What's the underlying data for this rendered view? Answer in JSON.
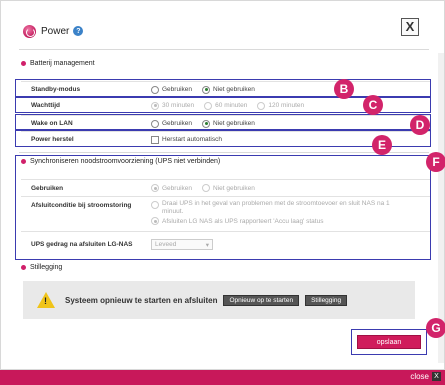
{
  "header": {
    "title": "Power",
    "help_icon": "?",
    "close_icon": "X"
  },
  "battery": {
    "section_title": "Batterij management",
    "standby": {
      "label": "Standby-modus",
      "options": [
        "Gebruiken",
        "Niet gebruiken"
      ],
      "selected": "Niet gebruiken"
    },
    "wait_time": {
      "label": "Wachttijd",
      "options": [
        "30 minuten",
        "60 minuten",
        "120 minuten"
      ],
      "selected": "30 minuten"
    },
    "wol": {
      "label": "Wake on LAN",
      "options": [
        "Gebruiken",
        "Niet gebruiken"
      ],
      "selected": "Niet gebruiken"
    },
    "power_restore": {
      "label": "Power herstel",
      "checkbox_label": "Herstart automatisch",
      "checked": false
    }
  },
  "ups": {
    "section_title": "Synchroniseren noodstroomvoorziening (UPS niet verbinden)",
    "use": {
      "label": "Gebruiken",
      "options": [
        "Gebruiken",
        "Niet gebruiken"
      ],
      "selected": "Gebruiken"
    },
    "shutdown_condition": {
      "label": "Afsluitconditie bij stroomstoring",
      "option1": "Draai UPS in het geval van problemen met de stroomtoevoer en sluit NAS na 1 minuut.",
      "option2": "Afsluiten LG NAS als UPS rapporteert 'Accu laag' status",
      "selected": 2
    },
    "behavior": {
      "label": "UPS gedrag na afsluiten LG-NAS",
      "select_value": "Leveed"
    }
  },
  "shutdown": {
    "section_title": "Stillegging",
    "text": "Systeem opnieuw te starten en afsluiten",
    "restart_button": "Opnieuw op te starten",
    "shutdown_button": "Stillegging"
  },
  "badges": [
    "B",
    "C",
    "D",
    "E",
    "F",
    "G"
  ],
  "save_button": "opslaan",
  "footer": {
    "close_label": "close",
    "close_icon": "X"
  },
  "colors": {
    "accent": "#d01c5c",
    "annotation_box": "#3b3bb0",
    "badge": "#d2246a"
  }
}
